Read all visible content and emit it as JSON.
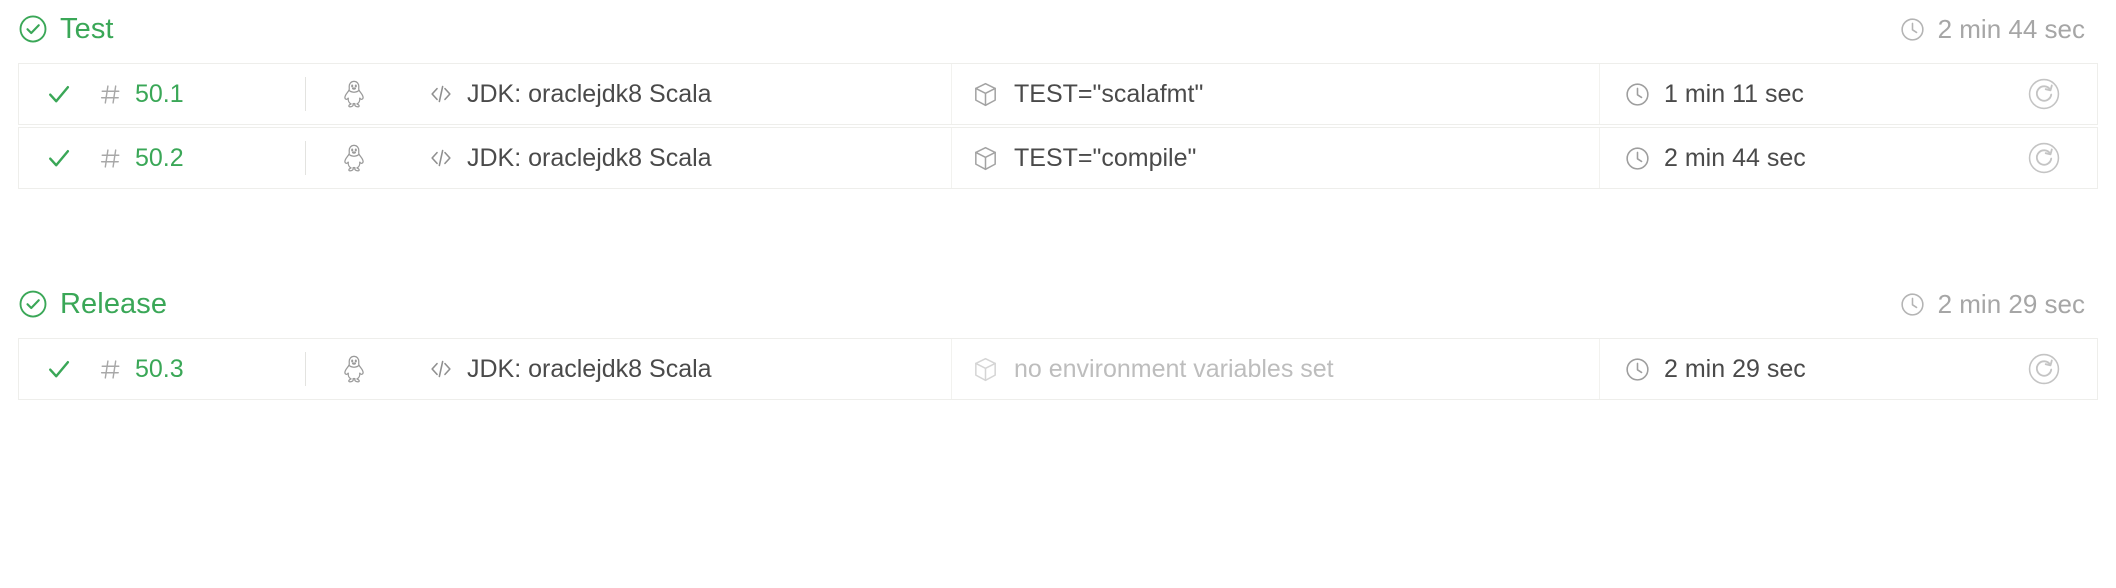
{
  "pipeline": {
    "stages": [
      {
        "name": "Test",
        "status": "passed",
        "status_icon": "check-circle-icon",
        "status_color": "#3aa757",
        "duration": "2 min 44 sec",
        "duration_icon": "clock-icon",
        "jobs": [
          {
            "status_icon": "check-icon",
            "hash_icon": "hash-icon",
            "build_number": "50.1",
            "build_number_color": "#3aa757",
            "os_icon": "linux-tux-icon",
            "config_icon": "code-icon",
            "config": "JDK: oraclejdk8 Scala",
            "env_icon": "cube-icon",
            "env": "TEST=\"scalafmt\"",
            "env_empty": false,
            "duration_icon": "clock-icon",
            "duration": "1 min 11 sec",
            "action_icon": "restart-icon"
          },
          {
            "status_icon": "check-icon",
            "hash_icon": "hash-icon",
            "build_number": "50.2",
            "build_number_color": "#3aa757",
            "os_icon": "linux-tux-icon",
            "config_icon": "code-icon",
            "config": "JDK: oraclejdk8 Scala",
            "env_icon": "cube-icon",
            "env": "TEST=\"compile\"",
            "env_empty": false,
            "duration_icon": "clock-icon",
            "duration": "2 min 44 sec",
            "action_icon": "restart-icon"
          }
        ]
      },
      {
        "name": "Release",
        "status": "passed",
        "status_icon": "check-circle-icon",
        "status_color": "#3aa757",
        "duration": "2 min 29 sec",
        "duration_icon": "clock-icon",
        "jobs": [
          {
            "status_icon": "check-icon",
            "hash_icon": "hash-icon",
            "build_number": "50.3",
            "build_number_color": "#3aa757",
            "os_icon": "linux-tux-icon",
            "config_icon": "code-icon",
            "config": "JDK: oraclejdk8 Scala",
            "env_icon": "cube-icon",
            "env": "no environment variables set",
            "env_empty": true,
            "duration_icon": "clock-icon",
            "duration": "2 min 29 sec",
            "action_icon": "restart-icon"
          }
        ]
      }
    ]
  },
  "colors": {
    "success_green": "#3aa757",
    "text_primary": "#4a4a4a",
    "text_muted": "#a6a6a6",
    "text_disabled": "#bdbdbd",
    "border": "#eeeeeb",
    "background": "#ffffff"
  }
}
